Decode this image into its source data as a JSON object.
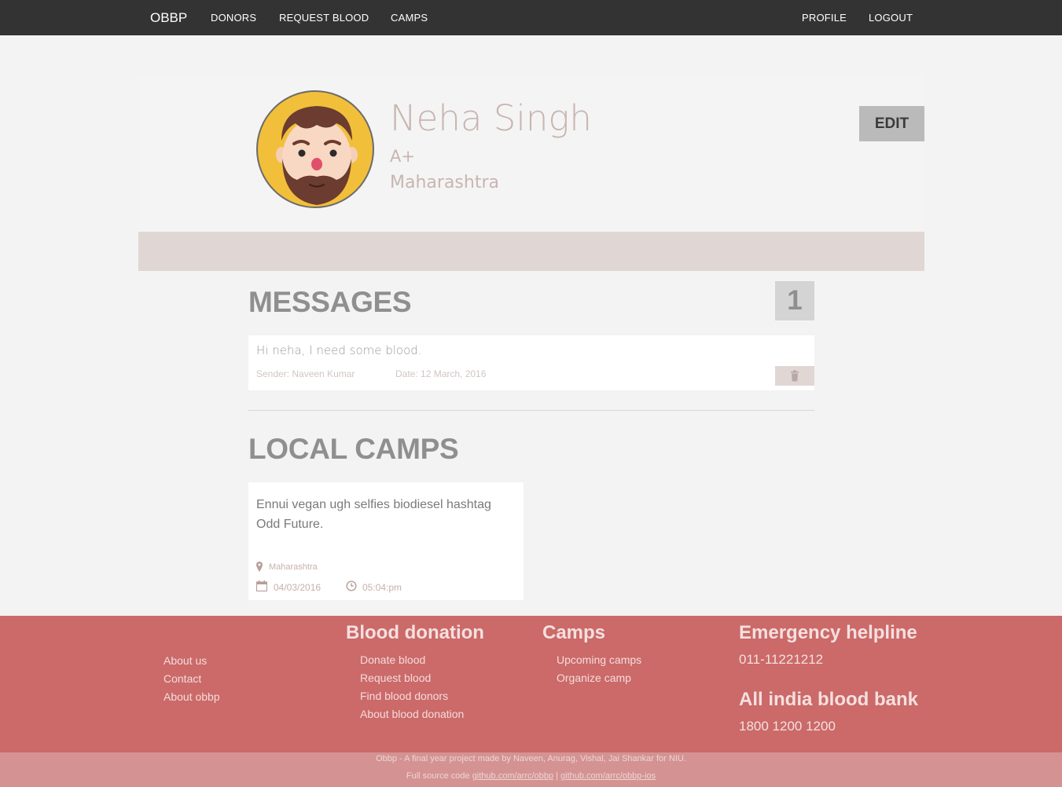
{
  "navbar": {
    "brand": "OBBP",
    "links": [
      "DONORS",
      "REQUEST BLOOD",
      "CAMPS"
    ],
    "right_links": [
      "PROFILE",
      "LOGOUT"
    ]
  },
  "profile": {
    "name": "Neha Singh",
    "blood_group": "A+",
    "state": "Maharashtra",
    "edit_label": "EDIT"
  },
  "messages": {
    "title": "MESSAGES",
    "count": "1",
    "items": [
      {
        "text": "Hi neha, I need some blood.",
        "sender": "Sender: Naveen Kumar",
        "date": "Date: 12 March, 2016",
        "delete_icon": "trash-icon"
      }
    ]
  },
  "camps": {
    "title": "LOCAL CAMPS",
    "items": [
      {
        "description": "Ennui vegan ugh selfies biodiesel hashtag Odd Future.",
        "location": "Maharashtra",
        "date": "04/03/2016",
        "time": "05:04:pm"
      }
    ]
  },
  "footer": {
    "col1": {
      "links": [
        "About us",
        "Contact",
        "About obbp"
      ]
    },
    "col2": {
      "heading": "Blood donation",
      "links": [
        "Donate blood",
        "Request blood",
        "Find blood donors",
        "About blood donation"
      ]
    },
    "col3": {
      "heading": "Camps",
      "links": [
        "Upcoming camps",
        "Organize camp"
      ]
    },
    "col4": {
      "heading": "Emergency helpline",
      "phone": "011-11221212",
      "heading2": "All india blood bank",
      "phone2": "1800 1200 1200"
    },
    "credit": "Obbp - A final year project made by Naveen, Anurag, Vishal, Jai Shankar for NIU.",
    "source_prefix": "Full source code",
    "source_link1": "github.com/arrc/obbp",
    "separator": "|",
    "source_link2": "github.com/arrc/obbp-ios"
  },
  "colors": {
    "navbar": "#333333",
    "footer": "#cb6a69",
    "subfooter": "#d49392",
    "accent_muted": "#c8b5b1"
  }
}
